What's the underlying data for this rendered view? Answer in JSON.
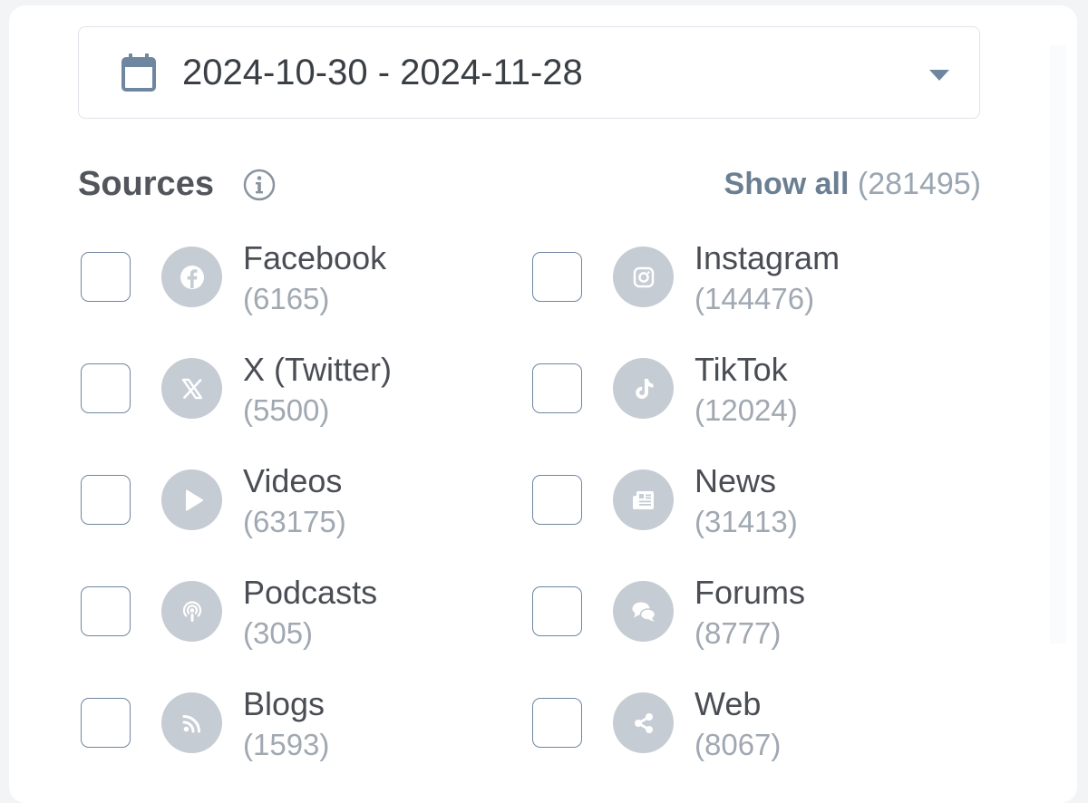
{
  "date_range": {
    "value": "2024-10-30 - 2024-11-28",
    "icon": "calendar-icon",
    "caret_icon": "caret-down-icon"
  },
  "sources": {
    "title": "Sources",
    "info_icon": "info-icon",
    "show_all_label": "Show all",
    "total_count": "(281495)",
    "items": [
      {
        "name": "Facebook",
        "count": "(6165)",
        "icon": "facebook-icon"
      },
      {
        "name": "Instagram",
        "count": "(144476)",
        "icon": "instagram-icon"
      },
      {
        "name": "X (Twitter)",
        "count": "(5500)",
        "icon": "x-twitter-icon"
      },
      {
        "name": "TikTok",
        "count": "(12024)",
        "icon": "tiktok-icon"
      },
      {
        "name": "Videos",
        "count": "(63175)",
        "icon": "play-icon"
      },
      {
        "name": "News",
        "count": "(31413)",
        "icon": "newspaper-icon"
      },
      {
        "name": "Podcasts",
        "count": "(305)",
        "icon": "podcast-icon"
      },
      {
        "name": "Forums",
        "count": "(8777)",
        "icon": "chat-bubbles-icon"
      },
      {
        "name": "Blogs",
        "count": "(1593)",
        "icon": "rss-icon"
      },
      {
        "name": "Web",
        "count": "(8067)",
        "icon": "share-icon"
      }
    ]
  },
  "colors": {
    "icon_circle": "#c6ccd4",
    "checkbox_border": "#6f86a0",
    "link": "#6b7f93",
    "muted_text": "#a0a8b2"
  }
}
